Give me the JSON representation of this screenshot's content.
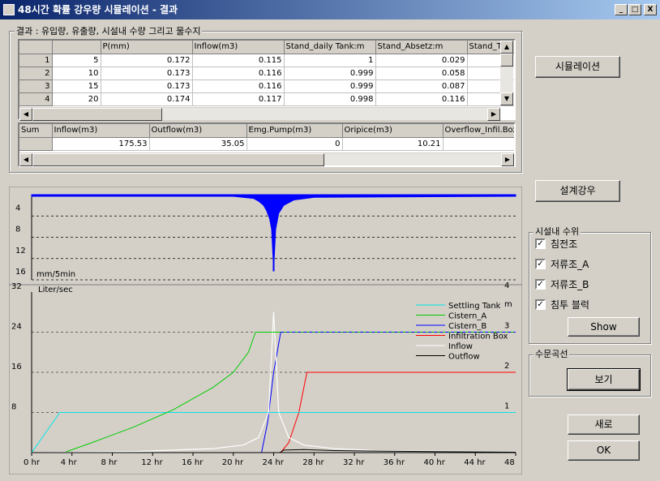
{
  "window": {
    "title": "48시간 확률 강우량 시뮬레이션 - 결과",
    "min": "_",
    "max": "□",
    "close": "X"
  },
  "results_group": {
    "label": "결과 : 유입량, 유출량, 시설내 수량 그리고 물수지"
  },
  "table1": {
    "headers": [
      "",
      "",
      "P(mm)",
      "Inflow(m3)",
      "Stand_daily Tank:m",
      "Stand_Absetz:m",
      "Stand_T"
    ],
    "rows": [
      [
        "1",
        "5",
        "0.172",
        "0.115",
        "1",
        "0.029",
        ""
      ],
      [
        "2",
        "10",
        "0.173",
        "0.116",
        "0.999",
        "0.058",
        ""
      ],
      [
        "3",
        "15",
        "0.173",
        "0.116",
        "0.999",
        "0.087",
        ""
      ],
      [
        "4",
        "20",
        "0.174",
        "0.117",
        "0.998",
        "0.116",
        ""
      ]
    ]
  },
  "table2": {
    "headers": [
      "Sum",
      "Inflow(m3)",
      "Outflow(m3)",
      "Emg.Pump(m3)",
      "Oripice(m3)",
      "Overflow_Infil.Box("
    ],
    "row": [
      "",
      "175.53",
      "35.05",
      "0",
      "10.21",
      ""
    ]
  },
  "buttons": {
    "simulation": "시뮬레이션",
    "design_rain": "설계강우",
    "show": "Show",
    "view": "보기",
    "new": "새로",
    "ok": "OK"
  },
  "level_group": {
    "label": "시설내 수위",
    "items": [
      {
        "label": "침전조",
        "checked": true
      },
      {
        "label": "저류조_A",
        "checked": true
      },
      {
        "label": "저류조_B",
        "checked": true
      },
      {
        "label": "침투 블럭",
        "checked": true
      }
    ]
  },
  "hydro_group": {
    "label": "수문곡선"
  },
  "colors": {
    "rain": "#0000ff",
    "settling": "#00e5e5",
    "cisternA": "#00cc00",
    "cisternB": "#0000ff",
    "infil": "#ff0000",
    "inflow": "#ffffff",
    "outflow": "#000000"
  },
  "chart_data": [
    {
      "type": "bar",
      "ylabel": "mm/5min",
      "yticks": [
        "4",
        "8",
        "12",
        "16"
      ],
      "ylim": [
        0,
        16
      ],
      "inverted": true,
      "x_hours": [
        0,
        20,
        22,
        22.5,
        23,
        23.3,
        23.6,
        23.8,
        24,
        24.2,
        24.5,
        25,
        26,
        28,
        48
      ],
      "values": [
        0.3,
        0.3,
        0.7,
        1.2,
        2.0,
        3.0,
        4.5,
        6.5,
        14,
        6.5,
        3.5,
        2.0,
        1.0,
        0.5,
        0.3
      ]
    },
    {
      "type": "line",
      "ylabel_left": "Liter/sec",
      "ylabel_right": "m",
      "yticks_left": [
        "8",
        "16",
        "24",
        "32"
      ],
      "yticks_right": [
        "1",
        "2",
        "3",
        "4"
      ],
      "ylim": [
        0,
        32
      ],
      "xticks": [
        "0 hr",
        "4 hr",
        "8 hr",
        "12 hr",
        "16 hr",
        "20 hr",
        "24 hr",
        "28 hr",
        "32 hr",
        "36 hr",
        "40 hr",
        "44 hr",
        "48"
      ],
      "series": [
        {
          "name": "Settling Tank",
          "x": [
            0,
            2.8,
            48
          ],
          "y": [
            0,
            8,
            8
          ]
        },
        {
          "name": "Cistern_A",
          "x": [
            3.2,
            6,
            10,
            14,
            18,
            20,
            21.5,
            22.2,
            48
          ],
          "y": [
            0,
            2,
            5,
            8.5,
            13,
            16,
            20,
            24,
            24
          ]
        },
        {
          "name": "Cistern_B",
          "x": [
            22.8,
            23.4,
            24,
            24.7,
            48
          ],
          "y": [
            0,
            6,
            16,
            24,
            24
          ]
        },
        {
          "name": "Infiltration Box",
          "x": [
            24.7,
            25.5,
            26.5,
            27.3,
            48
          ],
          "y": [
            0,
            2,
            8,
            16,
            16
          ]
        },
        {
          "name": "Inflow",
          "x": [
            0,
            10,
            18,
            21,
            22.5,
            23.5,
            24,
            24.5,
            25.5,
            27,
            30,
            34,
            48
          ],
          "y": [
            0,
            0.2,
            0.8,
            1.5,
            3,
            8,
            28,
            8,
            3,
            1.5,
            0.8,
            0.4,
            0.2
          ]
        },
        {
          "name": "Outflow",
          "x": [
            0,
            24.6,
            25,
            27,
            30,
            34,
            40,
            48
          ],
          "y": [
            0,
            0,
            0.5,
            0.6,
            0.4,
            0.3,
            0.2,
            0.1
          ]
        }
      ]
    }
  ]
}
